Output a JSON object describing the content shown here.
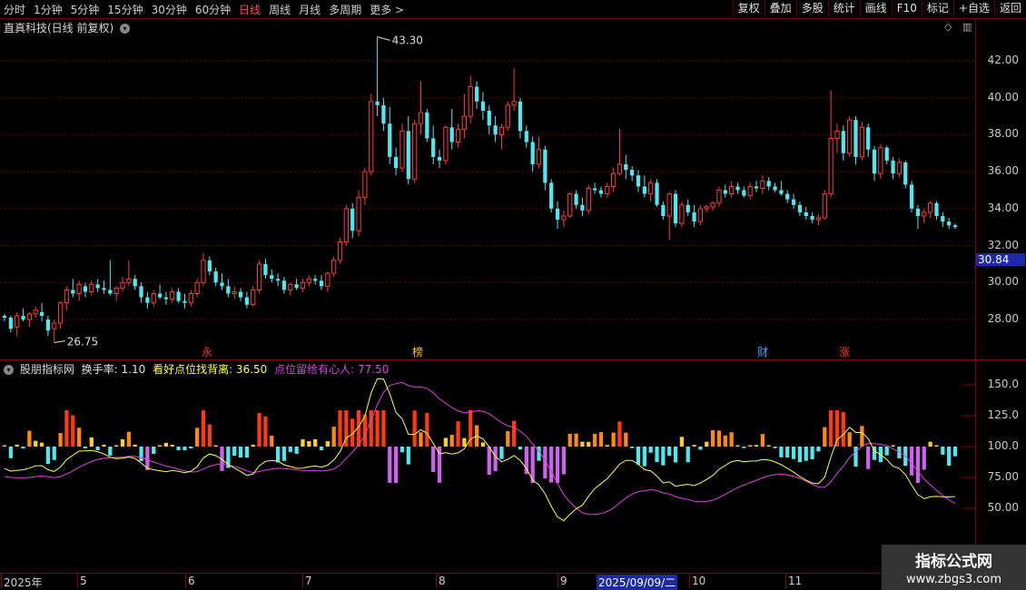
{
  "toolbar": {
    "periods": [
      "分时",
      "1分钟",
      "5分钟",
      "15分钟",
      "30分钟",
      "60分钟",
      "日线",
      "周线",
      "月线",
      "多周期",
      "更多 >"
    ],
    "active_period": "日线",
    "actions": [
      "复权",
      "叠加",
      "多股",
      "统计",
      "画线",
      "F10",
      "标记",
      "+自选",
      "返回"
    ]
  },
  "main_chart": {
    "title": "直真科技(日线 前复权)",
    "high_label": "43.30",
    "low_label": "26.75",
    "price_tag": "30.84",
    "y_ticks": [
      "42.00",
      "40.00",
      "38.00",
      "36.00",
      "34.00",
      "32.00",
      "30.00",
      "28.00"
    ],
    "markers": [
      {
        "text": "永",
        "color": "#ff3030"
      },
      {
        "text": "榜",
        "color": "#ffcc00"
      },
      {
        "text": "财",
        "color": "#40a0ff"
      },
      {
        "text": "涨",
        "color": "#ff3030"
      }
    ]
  },
  "indicator": {
    "name": "股朋指标网",
    "turnover": "换手率: 1.10",
    "line1": "看好点位找背离: 36.50",
    "line2": "点位留给有心人: 77.50",
    "y_ticks": [
      "150.0",
      "125.0",
      "100.0",
      "75.00",
      "50.00"
    ]
  },
  "dates": [
    "2025年",
    "5",
    "6",
    "7",
    "8",
    "9",
    "2025/09/09/二",
    "10",
    "11"
  ],
  "watermark": {
    "title": "指标公式网",
    "url": "www.zbgs3.com"
  },
  "chart_data": {
    "type": "candlestick",
    "ylim": [
      26.0,
      44.0
    ],
    "candles": [
      [
        28.2,
        28.3,
        27.9,
        28.1
      ],
      [
        28.1,
        28.2,
        27.3,
        27.5
      ],
      [
        27.6,
        28.4,
        27.1,
        28.2
      ],
      [
        28.2,
        28.6,
        27.9,
        28.0
      ],
      [
        28.0,
        28.4,
        27.6,
        28.3
      ],
      [
        28.3,
        28.7,
        28.1,
        28.5
      ],
      [
        28.4,
        28.9,
        27.9,
        28.2
      ],
      [
        28.0,
        28.2,
        27.1,
        27.4
      ],
      [
        27.5,
        28.0,
        26.75,
        27.8
      ],
      [
        27.8,
        29.0,
        27.5,
        28.9
      ],
      [
        28.9,
        29.8,
        28.5,
        29.6
      ],
      [
        29.6,
        30.2,
        29.2,
        29.4
      ],
      [
        29.4,
        30.1,
        29.0,
        29.9
      ],
      [
        29.8,
        30.0,
        29.2,
        29.5
      ],
      [
        29.5,
        30.1,
        29.3,
        29.9
      ],
      [
        29.9,
        30.2,
        29.5,
        29.7
      ],
      [
        29.7,
        30.1,
        29.4,
        29.6
      ],
      [
        29.6,
        31.2,
        29.3,
        29.4
      ],
      [
        29.4,
        29.8,
        29.0,
        29.7
      ],
      [
        29.7,
        30.3,
        29.5,
        30.0
      ],
      [
        30.0,
        31.2,
        29.8,
        30.2
      ],
      [
        30.2,
        30.4,
        29.6,
        29.8
      ],
      [
        29.8,
        30.0,
        28.9,
        29.2
      ],
      [
        29.2,
        29.5,
        28.6,
        28.9
      ],
      [
        28.9,
        29.6,
        28.7,
        29.4
      ],
      [
        29.4,
        29.9,
        29.1,
        29.2
      ],
      [
        29.2,
        29.5,
        28.8,
        29.1
      ],
      [
        29.1,
        29.7,
        28.9,
        29.5
      ],
      [
        29.5,
        29.7,
        28.9,
        29.0
      ],
      [
        29.0,
        29.4,
        28.6,
        28.9
      ],
      [
        28.9,
        29.6,
        28.7,
        29.4
      ],
      [
        29.4,
        30.2,
        29.2,
        30.0
      ],
      [
        30.0,
        31.6,
        29.8,
        31.2
      ],
      [
        31.2,
        31.4,
        30.4,
        30.6
      ],
      [
        30.6,
        30.8,
        29.8,
        30.0
      ],
      [
        30.0,
        30.5,
        29.6,
        29.8
      ],
      [
        29.8,
        30.2,
        29.2,
        29.4
      ],
      [
        29.4,
        29.8,
        29.1,
        29.5
      ],
      [
        29.5,
        29.7,
        29.0,
        29.2
      ],
      [
        29.2,
        29.5,
        28.6,
        28.8
      ],
      [
        28.8,
        29.8,
        28.7,
        29.6
      ],
      [
        29.6,
        31.2,
        29.4,
        31.0
      ],
      [
        31.0,
        31.3,
        30.2,
        30.4
      ],
      [
        30.4,
        30.7,
        30.0,
        30.2
      ],
      [
        30.2,
        30.5,
        29.8,
        30.1
      ],
      [
        30.1,
        30.3,
        29.4,
        29.6
      ],
      [
        29.6,
        30.0,
        29.3,
        29.9
      ],
      [
        29.9,
        30.2,
        29.6,
        29.7
      ],
      [
        29.7,
        30.2,
        29.5,
        30.0
      ],
      [
        30.0,
        30.4,
        29.8,
        30.2
      ],
      [
        30.2,
        30.4,
        29.9,
        30.1
      ],
      [
        30.1,
        30.4,
        29.6,
        29.8
      ],
      [
        29.8,
        30.6,
        29.5,
        30.5
      ],
      [
        30.5,
        31.4,
        30.3,
        31.2
      ],
      [
        31.2,
        32.4,
        31.0,
        32.2
      ],
      [
        32.2,
        34.2,
        32.0,
        34.0
      ],
      [
        34.0,
        34.3,
        32.4,
        32.8
      ],
      [
        32.8,
        35.0,
        32.5,
        34.6
      ],
      [
        34.6,
        36.2,
        34.2,
        36.0
      ],
      [
        36.0,
        40.2,
        35.8,
        39.8
      ],
      [
        39.8,
        43.3,
        39.0,
        39.6
      ],
      [
        39.6,
        40.0,
        38.2,
        38.6
      ],
      [
        38.6,
        39.5,
        36.4,
        36.8
      ],
      [
        36.8,
        37.3,
        35.8,
        36.2
      ],
      [
        36.2,
        38.6,
        36.0,
        38.2
      ],
      [
        38.2,
        39.0,
        35.3,
        35.6
      ],
      [
        35.6,
        38.8,
        35.4,
        38.6
      ],
      [
        38.6,
        40.9,
        38.0,
        39.2
      ],
      [
        39.2,
        39.4,
        37.6,
        37.8
      ],
      [
        37.8,
        38.5,
        36.4,
        36.8
      ],
      [
        36.8,
        37.2,
        36.2,
        36.6
      ],
      [
        36.6,
        38.5,
        36.4,
        38.4
      ],
      [
        38.4,
        39.4,
        37.2,
        37.6
      ],
      [
        37.6,
        38.6,
        37.3,
        38.3
      ],
      [
        38.3,
        40.2,
        37.8,
        39.0
      ],
      [
        39.0,
        41.2,
        38.6,
        40.6
      ],
      [
        40.6,
        40.9,
        39.4,
        39.8
      ],
      [
        39.8,
        40.3,
        38.8,
        39.3
      ],
      [
        39.3,
        39.6,
        38.0,
        38.5
      ],
      [
        38.5,
        39.0,
        37.6,
        38.0
      ],
      [
        38.0,
        38.6,
        37.2,
        38.4
      ],
      [
        38.4,
        39.8,
        38.2,
        39.6
      ],
      [
        39.6,
        41.6,
        39.3,
        39.8
      ],
      [
        39.8,
        40.0,
        37.8,
        38.2
      ],
      [
        38.2,
        38.5,
        37.3,
        37.6
      ],
      [
        37.6,
        37.9,
        36.0,
        36.4
      ],
      [
        36.4,
        37.9,
        36.2,
        37.2
      ],
      [
        37.2,
        37.4,
        35.0,
        35.4
      ],
      [
        35.4,
        35.6,
        33.8,
        34.0
      ],
      [
        34.0,
        34.4,
        32.9,
        33.4
      ],
      [
        33.4,
        33.9,
        33.0,
        33.6
      ],
      [
        33.6,
        34.9,
        33.5,
        34.8
      ],
      [
        34.8,
        35.0,
        34.0,
        34.2
      ],
      [
        34.2,
        34.6,
        33.6,
        33.9
      ],
      [
        33.9,
        35.3,
        33.7,
        35.1
      ],
      [
        35.1,
        35.4,
        34.8,
        35.0
      ],
      [
        35.0,
        35.2,
        34.6,
        34.8
      ],
      [
        34.8,
        35.4,
        34.6,
        35.2
      ],
      [
        35.2,
        36.2,
        34.9,
        35.9
      ],
      [
        35.9,
        38.3,
        35.8,
        36.4
      ],
      [
        36.4,
        36.9,
        35.6,
        36.1
      ],
      [
        36.1,
        36.3,
        35.5,
        35.8
      ],
      [
        35.8,
        36.1,
        34.9,
        35.2
      ],
      [
        35.2,
        35.8,
        34.6,
        34.8
      ],
      [
        34.8,
        35.6,
        34.4,
        35.4
      ],
      [
        35.4,
        35.6,
        34.1,
        34.2
      ],
      [
        34.2,
        34.4,
        33.4,
        33.6
      ],
      [
        33.6,
        34.9,
        32.3,
        34.8
      ],
      [
        34.8,
        35.0,
        33.0,
        33.2
      ],
      [
        33.2,
        34.4,
        33.0,
        34.2
      ],
      [
        34.2,
        34.5,
        33.6,
        33.8
      ],
      [
        33.8,
        34.2,
        33.0,
        33.3
      ],
      [
        33.3,
        34.2,
        33.1,
        34.0
      ],
      [
        34.0,
        34.2,
        33.8,
        34.1
      ],
      [
        34.1,
        34.4,
        33.9,
        34.3
      ],
      [
        34.3,
        35.2,
        34.1,
        35.0
      ],
      [
        35.0,
        35.3,
        34.6,
        34.8
      ],
      [
        34.8,
        35.5,
        34.6,
        35.2
      ],
      [
        35.2,
        35.4,
        34.8,
        35.0
      ],
      [
        35.0,
        35.2,
        34.6,
        34.7
      ],
      [
        34.7,
        35.4,
        34.5,
        35.2
      ],
      [
        35.2,
        35.5,
        34.9,
        35.1
      ],
      [
        35.1,
        35.8,
        34.8,
        35.5
      ],
      [
        35.5,
        35.7,
        35.0,
        35.2
      ],
      [
        35.2,
        35.4,
        34.9,
        35.0
      ],
      [
        35.0,
        35.5,
        34.7,
        34.8
      ],
      [
        34.8,
        35.0,
        34.3,
        34.5
      ],
      [
        34.5,
        34.8,
        34.0,
        34.2
      ],
      [
        34.2,
        34.4,
        33.6,
        33.8
      ],
      [
        33.8,
        34.1,
        33.4,
        33.6
      ],
      [
        33.6,
        33.8,
        33.2,
        33.4
      ],
      [
        33.4,
        33.7,
        33.1,
        33.5
      ],
      [
        33.5,
        35.0,
        33.4,
        34.8
      ],
      [
        34.8,
        40.4,
        34.6,
        37.8
      ],
      [
        37.8,
        38.6,
        37.0,
        38.2
      ],
      [
        38.2,
        38.5,
        36.6,
        37.0
      ],
      [
        37.0,
        39.0,
        36.8,
        38.8
      ],
      [
        38.8,
        39.0,
        36.4,
        36.8
      ],
      [
        36.8,
        38.7,
        36.6,
        38.4
      ],
      [
        38.4,
        38.6,
        36.8,
        37.2
      ],
      [
        37.2,
        37.4,
        35.5,
        35.9
      ],
      [
        35.9,
        37.5,
        35.6,
        37.3
      ],
      [
        37.3,
        37.4,
        36.4,
        36.6
      ],
      [
        36.6,
        36.8,
        35.6,
        35.9
      ],
      [
        35.9,
        36.7,
        35.7,
        36.5
      ],
      [
        36.5,
        36.6,
        35.1,
        35.3
      ],
      [
        35.3,
        35.5,
        33.8,
        34.0
      ],
      [
        34.0,
        34.2,
        32.9,
        33.6
      ],
      [
        33.6,
        34.0,
        33.2,
        33.8
      ],
      [
        33.8,
        34.4,
        33.5,
        34.3
      ],
      [
        34.3,
        34.4,
        33.4,
        33.6
      ],
      [
        33.6,
        33.8,
        33.0,
        33.3
      ],
      [
        33.3,
        33.5,
        32.9,
        33.1
      ],
      [
        33.1,
        33.2,
        32.9,
        33.0
      ]
    ],
    "indicator_series": [
      {
        "name": "看好点位找背离",
        "color": "#ffff40"
      },
      {
        "name": "点位留给有心人",
        "color": "#e040e0"
      }
    ]
  }
}
